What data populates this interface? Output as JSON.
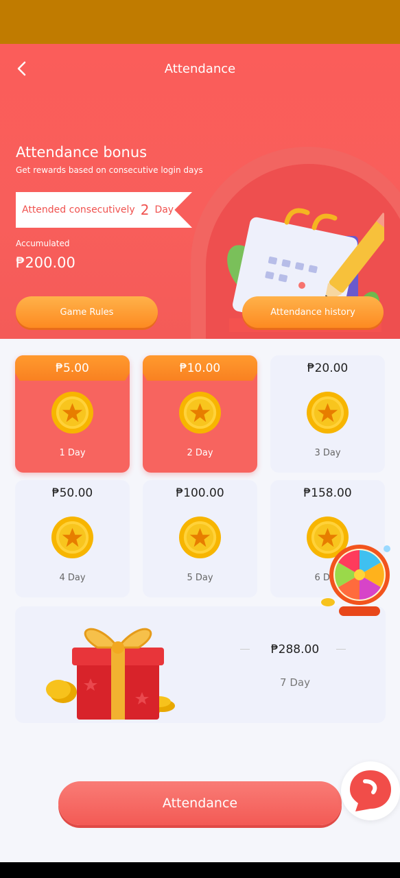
{
  "header": {
    "title": "Attendance",
    "bonus_title": "Attendance bonus",
    "bonus_subtitle": "Get rewards based on consecutive login days",
    "consecutive_label": "Attended consecutively",
    "consecutive_days": "2",
    "consecutive_unit": "Day",
    "accumulated_label": "Accumulated",
    "accumulated_value": "₱200.00",
    "rules_button": "Game Rules",
    "history_button": "Attendance history"
  },
  "rewards": [
    {
      "amount": "₱5.00",
      "day": "1 Day",
      "claimed": true
    },
    {
      "amount": "₱10.00",
      "day": "2 Day",
      "claimed": true
    },
    {
      "amount": "₱20.00",
      "day": "3 Day",
      "claimed": false
    },
    {
      "amount": "₱50.00",
      "day": "4 Day",
      "claimed": false
    },
    {
      "amount": "₱100.00",
      "day": "5 Day",
      "claimed": false
    },
    {
      "amount": "₱158.00",
      "day": "6 Day",
      "claimed": false
    }
  ],
  "bonus_reward": {
    "amount": "₱288.00",
    "day": "7 Day"
  },
  "attendance_button": "Attendance",
  "icons": {
    "back": "chevron-left-icon",
    "coin": "star-coin-icon",
    "gift": "gift-box-icon",
    "calendar": "calendar-pencil-icon",
    "wheel": "lucky-wheel-icon",
    "chat": "chat-support-icon"
  },
  "colors": {
    "primary": "#f85e5b",
    "accent_orange": "#fd8a21",
    "status_bar": "#c07b00",
    "card_bg": "#eff1fb"
  }
}
